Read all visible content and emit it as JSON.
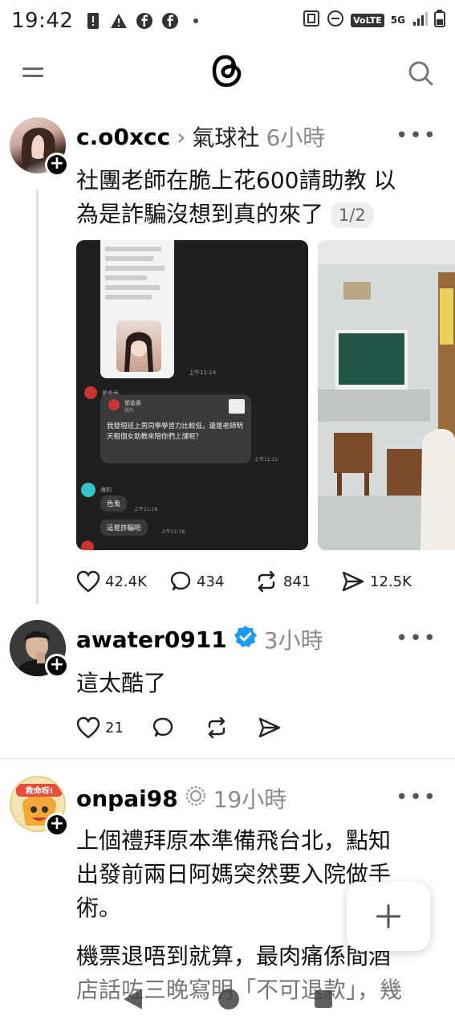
{
  "status_bar": {
    "time": "19:42",
    "left_icons": [
      "sim-alert-icon",
      "warning-icon",
      "facebook-icon",
      "facebook-icon",
      "dot-icon"
    ],
    "right_icons": [
      "nfc-icon",
      "dnd-icon",
      "volte-icon",
      "5g-icon",
      "signal-icon",
      "battery-icon"
    ],
    "volte_label": "VoLTE",
    "net_label": "5G"
  },
  "top_bar": {
    "menu_icon": "menu-icon",
    "logo": "threads-logo",
    "search_icon": "search-icon"
  },
  "posts": [
    {
      "username": "c.o0xcc",
      "community": "氣球社",
      "time_ago": "6小時",
      "text_line1": "社團老師在脆上花600請助教 以",
      "text_line2": "為是詐騙沒想到真的來了",
      "pager": "1/2",
      "chat_screenshot": {
        "sender": "鄧金香",
        "attachment": "照片",
        "message": "我發現班上男同學學習力比較低，還是老師明天租個女助教來陪你們上課呢？",
        "msg_time": "上午11:15",
        "reply1_name": "海豹",
        "reply1": "色鬼",
        "reply1_time": "上午11:18",
        "reply2": "這是詐騙吧",
        "reply2_time": "上午11:18",
        "top_time": "上午11:14"
      },
      "likes": "42.4K",
      "comments": "434",
      "reposts": "841",
      "shares": "12.5K"
    },
    {
      "username": "awater0911",
      "verified": true,
      "time_ago": "3小時",
      "text": "這太酷了",
      "likes": "21"
    },
    {
      "username": "onpai98",
      "time_ago": "19小時",
      "avatar_text": "救命呀!",
      "text_line1": "上個禮拜原本準備飛台北，點知",
      "text_line2": "出發前兩日阿媽突然要入院做手",
      "text_line3": "術。",
      "text_line4": "機票退唔到就算，最肉痛係間酒",
      "text_line5": "店話咗三晚寫明「不可退款」，幾"
    }
  ],
  "fab_icon": "plus-icon",
  "nav_bar": [
    "back-icon",
    "home-icon",
    "recents-icon"
  ]
}
